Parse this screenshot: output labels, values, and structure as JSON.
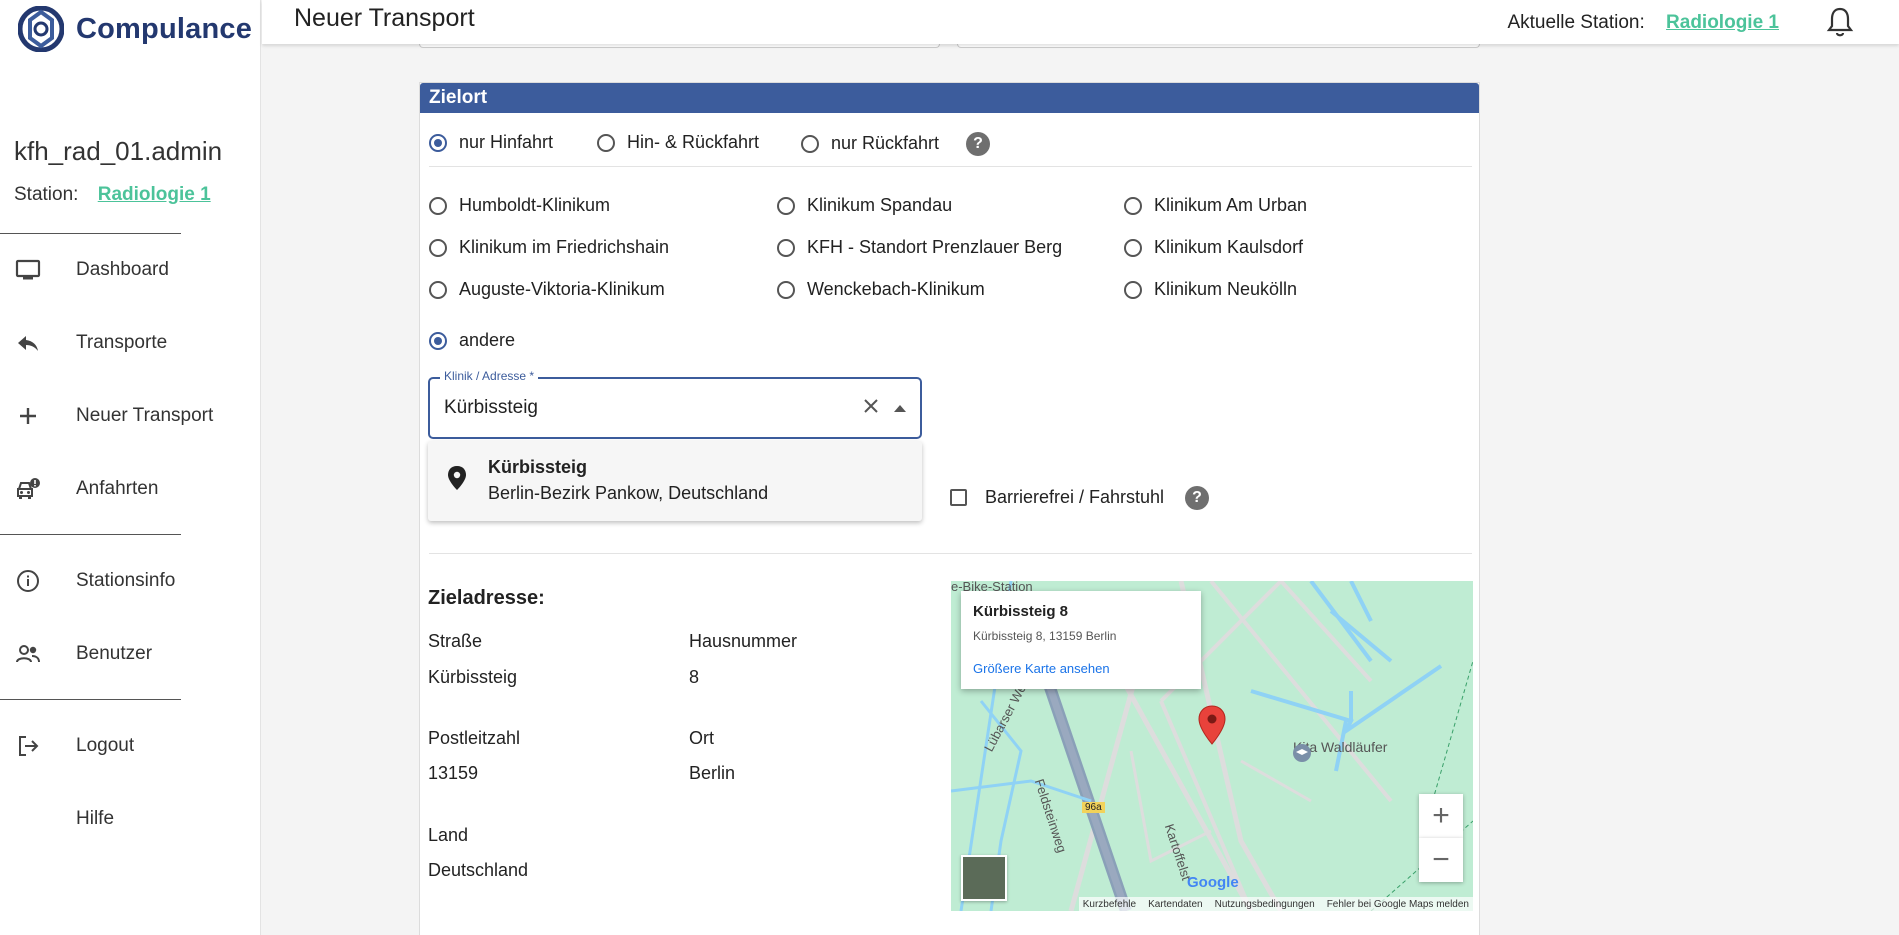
{
  "app": {
    "name": "Compulance",
    "page_title": "Neuer Transport"
  },
  "header": {
    "station_label": "Aktuelle Station:",
    "station_value": "Radiologie 1"
  },
  "sidebar": {
    "user": "kfh_rad_01.admin",
    "station_label": "Station:",
    "station_value": "Radiologie 1",
    "items": [
      {
        "label": "Dashboard",
        "icon": "monitor-icon"
      },
      {
        "label": "Transporte",
        "icon": "reply-icon"
      },
      {
        "label": "Neuer Transport",
        "icon": "plus-icon"
      },
      {
        "label": "Anfahrten",
        "icon": "car-alert-icon"
      },
      {
        "label": "Stationsinfo",
        "icon": "info-icon"
      },
      {
        "label": "Benutzer",
        "icon": "people-icon"
      },
      {
        "label": "Logout",
        "icon": "logout-icon"
      },
      {
        "label": "Hilfe",
        "icon": ""
      }
    ]
  },
  "zielort": {
    "title": "Zielort",
    "trip_options": [
      "nur Hinfahrt",
      "Hin- & Rückfahrt",
      "nur Rückfahrt"
    ],
    "trip_selected": "nur Hinfahrt",
    "clinics": [
      "Humboldt-Klinikum",
      "Klinikum Spandau",
      "Klinikum Am Urban",
      "Klinikum im Friedrichshain",
      "KFH - Standort Prenzlauer Berg",
      "Klinikum Kaulsdorf",
      "Auguste-Viktoria-Klinikum",
      "Wenckebach-Klinikum",
      "Klinikum Neukölln"
    ],
    "other_label": "andere",
    "other_selected": true,
    "field_label": "Klinik / Adresse *",
    "field_value": "Kürbissteig",
    "suggestion_title": "Kürbissteig",
    "suggestion_sub": "Berlin-Bezirk Pankow, Deutschland",
    "barrier_label": "Barrierefrei / Fahrstuhl",
    "barrier_checked": false
  },
  "address": {
    "title": "Zieladresse:",
    "street_label": "Straße",
    "street": "Kürbissteig",
    "number_label": "Hausnummer",
    "number": "8",
    "zip_label": "Postleitzahl",
    "zip": "13159",
    "city_label": "Ort",
    "city": "Berlin",
    "country_label": "Land",
    "country": "Deutschland"
  },
  "map": {
    "info_title": "Kürbissteig 8",
    "info_address": "Kürbissteig 8, 13159 Berlin",
    "info_link": "Größere Karte ansehen",
    "labels": [
      "e-Bike-Station",
      "Kita Waldläufer",
      "Lübarser Weg",
      "Feldsteinweg",
      "Kartoffelst",
      "96a",
      "Google"
    ],
    "footer": [
      "Kurzbefehle",
      "Kartendaten",
      "Nutzungsbedingungen",
      "Fehler bei Google Maps melden"
    ]
  }
}
